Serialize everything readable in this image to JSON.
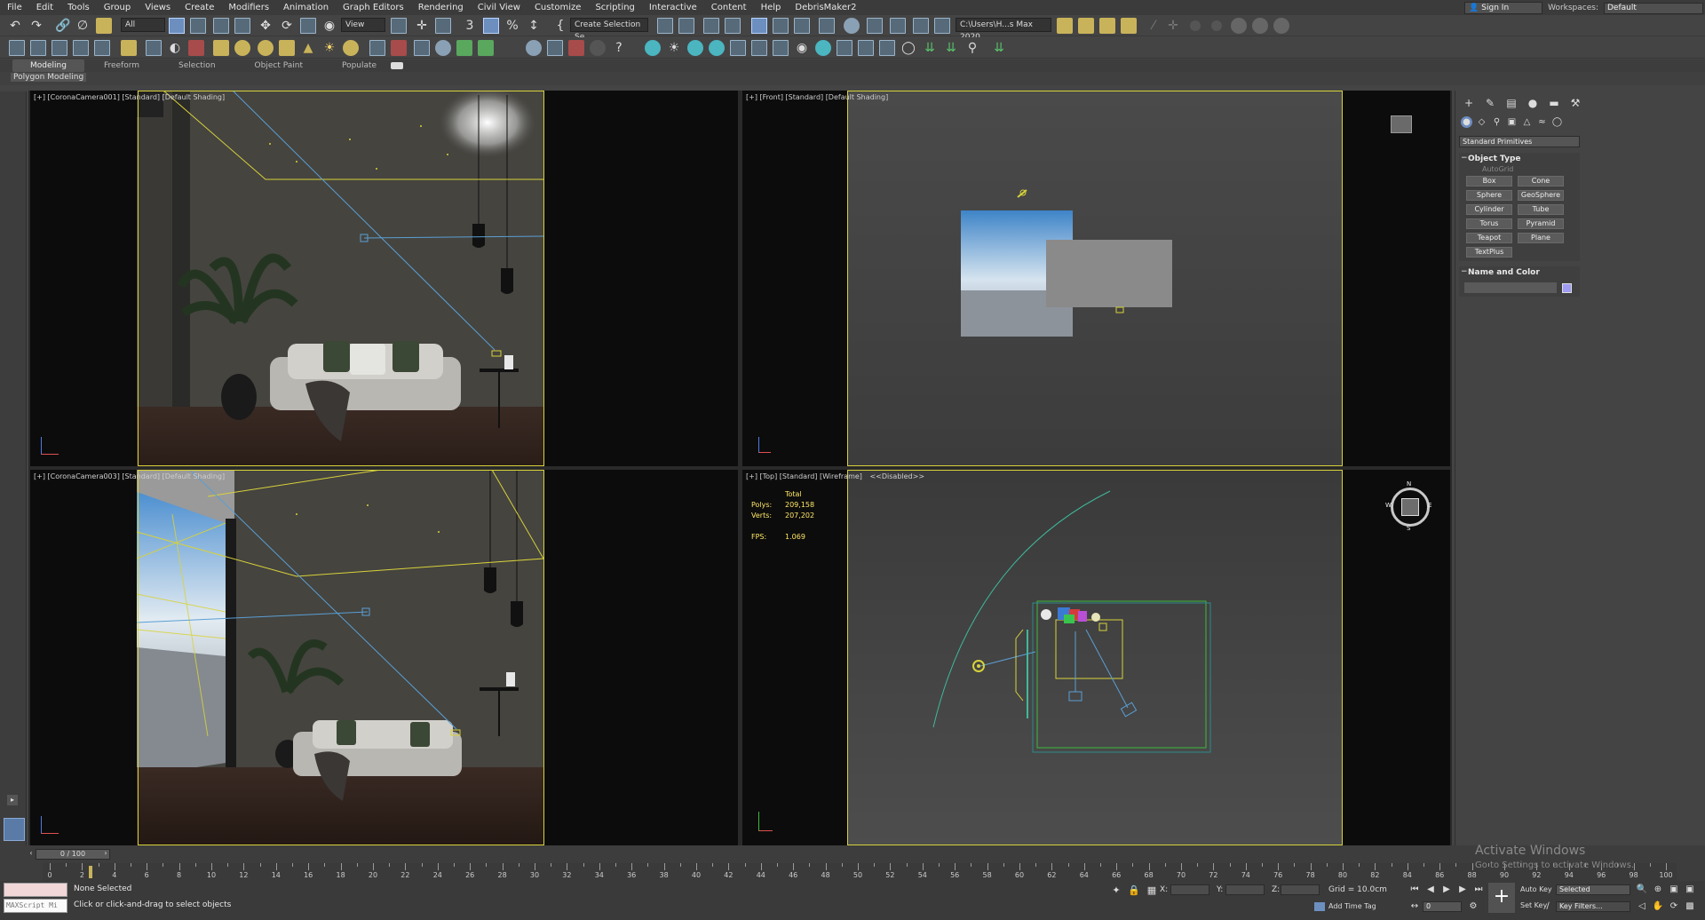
{
  "menu": [
    "File",
    "Edit",
    "Tools",
    "Group",
    "Views",
    "Create",
    "Modifiers",
    "Animation",
    "Graph Editors",
    "Rendering",
    "Civil View",
    "Customize",
    "Scripting",
    "Interactive",
    "Content",
    "Help",
    "DebrisMaker2"
  ],
  "account": {
    "sign_in": "Sign In",
    "workspaces_label": "Workspaces:",
    "workspace_value": "Default"
  },
  "toolbar": {
    "selection_filter": "All",
    "ref_coord": "View",
    "create_selection_set": "Create Selection Se",
    "path_field": "C:\\Users\\H...s Max 2020"
  },
  "ribbon": {
    "tabs": [
      "Modeling",
      "Freeform",
      "Selection",
      "Object Paint",
      "Populate"
    ],
    "active_tab": "Modeling",
    "panel_label": "Polygon Modeling"
  },
  "viewports": {
    "top_left": {
      "label": "[+] [CoronaCamera001] [Standard] [Default Shading]"
    },
    "top_right": {
      "label": "[+] [Front] [Standard] [Default Shading]"
    },
    "bottom_left": {
      "label": "[+] [CoronaCamera003] [Standard] [Default Shading]"
    },
    "bottom_right": {
      "label": "[+] [Top] [Standard] [Wireframe]",
      "disabled_label": "<<Disabled>>",
      "stats": {
        "total": "Total",
        "polys_label": "Polys:",
        "polys": "209,158",
        "verts_label": "Verts:",
        "verts": "207,202",
        "fps_label": "FPS:",
        "fps": "1.069"
      },
      "compass": {
        "n": "N",
        "s": "S",
        "e": "E",
        "w": "W"
      }
    }
  },
  "command_panel": {
    "category": "Standard Primitives",
    "object_type_title": "Object Type",
    "autogrid": "AutoGrid",
    "primitives": [
      "Box",
      "Cone",
      "Sphere",
      "GeoSphere",
      "Cylinder",
      "Tube",
      "Torus",
      "Pyramid",
      "Teapot",
      "Plane",
      "TextPlus"
    ],
    "name_color_title": "Name and Color",
    "color": "#9e9cf3"
  },
  "timeline": {
    "frame_display": "0 / 100",
    "ticks": [
      "0",
      "2",
      "4",
      "6",
      "8",
      "10",
      "12",
      "14",
      "16",
      "18",
      "20",
      "22",
      "24",
      "26",
      "28",
      "30",
      "32",
      "34",
      "36",
      "38",
      "40",
      "42",
      "44",
      "46",
      "48",
      "50",
      "52",
      "54",
      "56",
      "58",
      "60",
      "62",
      "64",
      "66",
      "68",
      "70",
      "72",
      "74",
      "76",
      "78",
      "80",
      "82",
      "84",
      "86",
      "88",
      "90",
      "92",
      "94",
      "96",
      "98",
      "100"
    ]
  },
  "status": {
    "maxscript_placeholder": "MAXScript Mi",
    "selection": "None Selected",
    "prompt": "Click or click-and-drag to select objects",
    "x_label": "X:",
    "y_label": "Y:",
    "z_label": "Z:",
    "grid": "Grid = 10.0cm",
    "add_time_tag": "Add Time Tag",
    "auto_key": "Auto Key",
    "set_key": "Set Key",
    "selected": "Selected",
    "key_filters": "Key Filters...",
    "frame": "0"
  },
  "watermark": {
    "title": "Activate Windows",
    "subtitle": "Go to Settings to activate Windows."
  }
}
